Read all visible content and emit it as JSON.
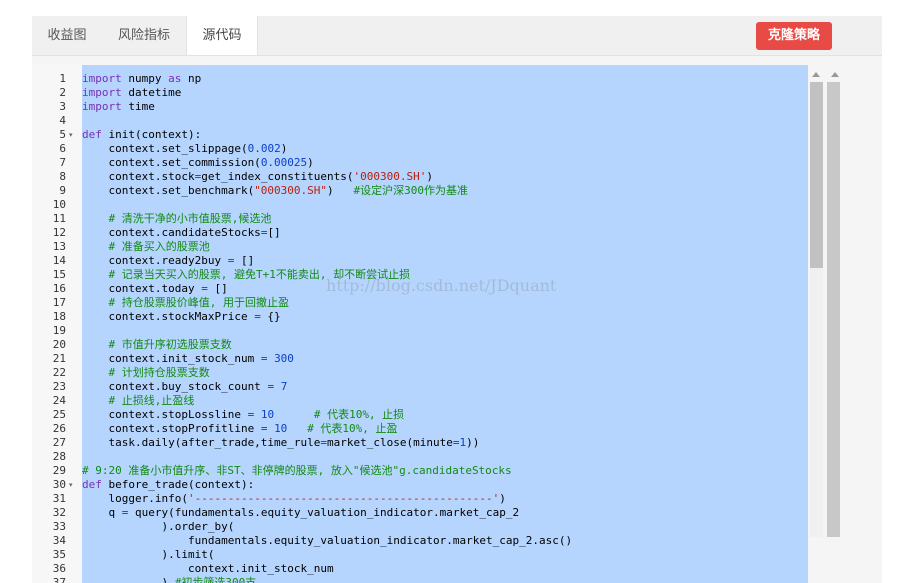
{
  "tabs": [
    {
      "label": "收益图",
      "active": false
    },
    {
      "label": "风险指标",
      "active": false
    },
    {
      "label": "源代码",
      "active": true
    }
  ],
  "clone_button": {
    "label": "克隆策略",
    "color": "#e84a45"
  },
  "selection_color": "#b5d5ff",
  "watermark": "http://blog.csdn.net/JDquant",
  "code_lines": [
    {
      "n": 1,
      "fold": false,
      "text": "import numpy as np"
    },
    {
      "n": 2,
      "fold": false,
      "text": "import datetime"
    },
    {
      "n": 3,
      "fold": false,
      "text": "import time"
    },
    {
      "n": 4,
      "fold": false,
      "text": ""
    },
    {
      "n": 5,
      "fold": true,
      "text": "def init(context):"
    },
    {
      "n": 6,
      "fold": false,
      "text": "    context.set_slippage(0.002)"
    },
    {
      "n": 7,
      "fold": false,
      "text": "    context.set_commission(0.00025)"
    },
    {
      "n": 8,
      "fold": false,
      "text": "    context.stock=get_index_constituents('000300.SH')"
    },
    {
      "n": 9,
      "fold": false,
      "text": "    context.set_benchmark(\"000300.SH\")   #设定沪深300作为基准"
    },
    {
      "n": 10,
      "fold": false,
      "text": ""
    },
    {
      "n": 11,
      "fold": false,
      "text": "    # 清洗干净的小市值股票,候选池"
    },
    {
      "n": 12,
      "fold": false,
      "text": "    context.candidateStocks=[]"
    },
    {
      "n": 13,
      "fold": false,
      "text": "    # 准备买入的股票池"
    },
    {
      "n": 14,
      "fold": false,
      "text": "    context.ready2buy = []"
    },
    {
      "n": 15,
      "fold": false,
      "text": "    # 记录当天买入的股票, 避免T+1不能卖出, 却不断尝试止损"
    },
    {
      "n": 16,
      "fold": false,
      "text": "    context.today = []"
    },
    {
      "n": 17,
      "fold": false,
      "text": "    # 持仓股票股价峰值, 用于回撤止盈"
    },
    {
      "n": 18,
      "fold": false,
      "text": "    context.stockMaxPrice = {}"
    },
    {
      "n": 19,
      "fold": false,
      "text": ""
    },
    {
      "n": 20,
      "fold": false,
      "text": "    # 市值升序初选股票支数"
    },
    {
      "n": 21,
      "fold": false,
      "text": "    context.init_stock_num = 300"
    },
    {
      "n": 22,
      "fold": false,
      "text": "    # 计划持仓股票支数"
    },
    {
      "n": 23,
      "fold": false,
      "text": "    context.buy_stock_count = 7"
    },
    {
      "n": 24,
      "fold": false,
      "text": "    # 止损线,止盈线"
    },
    {
      "n": 25,
      "fold": false,
      "text": "    context.stopLossline = 10      # 代表10%, 止损"
    },
    {
      "n": 26,
      "fold": false,
      "text": "    context.stopProfitline = 10   # 代表10%, 止盈"
    },
    {
      "n": 27,
      "fold": false,
      "text": "    task.daily(after_trade,time_rule=market_close(minute=1))"
    },
    {
      "n": 28,
      "fold": false,
      "text": ""
    },
    {
      "n": 29,
      "fold": false,
      "text": "# 9:20 准备小市值升序、非ST、非停牌的股票, 放入\"候选池\"g.candidateStocks"
    },
    {
      "n": 30,
      "fold": true,
      "text": "def before_trade(context):"
    },
    {
      "n": 31,
      "fold": false,
      "text": "    logger.info('---------------------------------------------')"
    },
    {
      "n": 32,
      "fold": false,
      "text": "    q = query(fundamentals.equity_valuation_indicator.market_cap_2"
    },
    {
      "n": 33,
      "fold": false,
      "text": "            ).order_by("
    },
    {
      "n": 34,
      "fold": false,
      "text": "                fundamentals.equity_valuation_indicator.market_cap_2.asc()"
    },
    {
      "n": 35,
      "fold": false,
      "text": "            ).limit("
    },
    {
      "n": 36,
      "fold": false,
      "text": "                context.init_stock_num"
    },
    {
      "n": 37,
      "fold": false,
      "text": "            ) #初步筛选300支"
    }
  ]
}
